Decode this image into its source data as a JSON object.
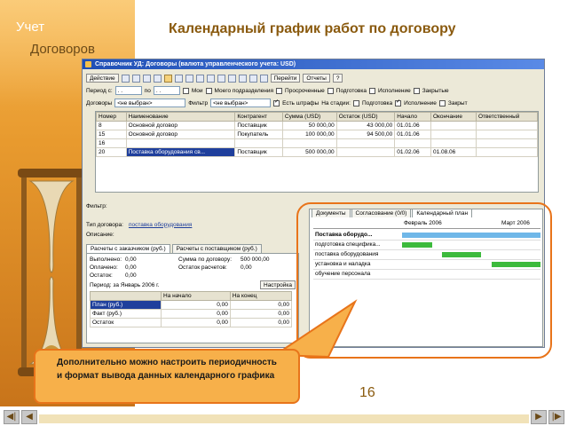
{
  "slide": {
    "left_title_1": "Учет",
    "left_title_2": "Договоров",
    "title": "Календарный график работ по договору",
    "page_number": "16",
    "callout": "Дополнительно можно настроить периодичность и формат вывода данных календарного графика"
  },
  "window": {
    "title": "Справочник УД: Договоры (валюта управленческого учета: USD)",
    "toolbar": {
      "action_label": "Действие",
      "goto_label": "Перейти",
      "reports_label": "Отчеты",
      "help_label": "?"
    },
    "filter_row1": {
      "period_label": "Период с:",
      "period_from": ". .",
      "period_to_label": "по",
      "period_to": ". .",
      "mine_label": "Мои",
      "my_division_label": "Моего подразделения",
      "overdue_label": "Просроченные",
      "preparation_label": "Подготовка",
      "execution_label": "Исполнение",
      "closed_label": "Закрытые"
    },
    "filter_row2": {
      "contracts_label": "Договоры",
      "contracts_value": "<не выбран>",
      "filter_label": "Фильтр",
      "filter_value": "<не выбран>",
      "fines_label": "Есть штрафы",
      "stage_label": "На стадии:",
      "preparation_label": "Подготовка",
      "execution_label": "Исполнение",
      "closed_label": "Закрыт"
    },
    "table": {
      "columns": [
        "Номер",
        "Наименование",
        "Контрагент",
        "Сумма (USD)",
        "Остаток (USD)",
        "Начало",
        "Окончание",
        "Ответственный"
      ],
      "rows": [
        [
          "8",
          "Основной договор",
          "Поставщик",
          "50 000,00",
          "43 000,00",
          "01.01.06",
          "",
          ""
        ],
        [
          "15",
          "Основной договор",
          "Покупатель",
          "100 000,00",
          "94 500,00",
          "01.01.06",
          "",
          ""
        ],
        [
          "16",
          "",
          "",
          "",
          "",
          "",
          "",
          ""
        ],
        [
          "20",
          "Поставка оборудования св...",
          "Поставщик",
          "500 000,00",
          "",
          "01.02.06",
          "01.08.06",
          ""
        ]
      ]
    },
    "details": {
      "filter_label": "Фильтр:",
      "contract_type_label": "Тип договора:",
      "contract_type_value": "поставка оборудования",
      "description_label": "Описание:",
      "tab_customer": "Расчеты с заказчиком (руб.)",
      "tab_supplier": "Расчеты с поставщиком (руб.)",
      "done_label": "Выполнено:",
      "done_value": "0,00",
      "contract_sum_label": "Сумма по договору:",
      "contract_sum_value": "500 000,00",
      "paid_label": "Оплачено:",
      "paid_value": "0,00",
      "balance_calc_label": "Остаток расчетов:",
      "balance_calc_value": "0,00",
      "balance_label": "Остаток:",
      "balance_value": "0,00",
      "period_label": "Период:",
      "period_value": "за Январь 2006 г.",
      "settings_label": "Настройка",
      "subtable": {
        "columns": [
          "",
          "На начало",
          "На конец"
        ],
        "rows": [
          [
            "План (руб.)",
            "0,00",
            "0,00"
          ],
          [
            "Факт (руб.)",
            "0,00",
            "0,00"
          ],
          [
            "Остаток",
            "0,00",
            "0,00"
          ]
        ]
      }
    },
    "gantt": {
      "tabs": [
        "Документы",
        "Согласование (0/0)",
        "Календарный план"
      ],
      "month_1": "Февраль 2006",
      "month_2": "Март 2006",
      "tasks": [
        {
          "label": "Поставка оборудо...",
          "start": 0.0,
          "end": 1.0,
          "color": "#6fb7e8"
        },
        {
          "label": "подготовка специфика...",
          "start": 0.0,
          "end": 0.22,
          "color": "#3cba3c"
        },
        {
          "label": "поставка оборудования",
          "start": 0.29,
          "end": 0.57,
          "color": "#3cba3c"
        },
        {
          "label": "установка и наладка",
          "start": 0.65,
          "end": 1.0,
          "color": "#3cba3c"
        },
        {
          "label": "обучение персонала",
          "start": 0.0,
          "end": 0.0,
          "color": "#3cba3c"
        }
      ]
    }
  }
}
